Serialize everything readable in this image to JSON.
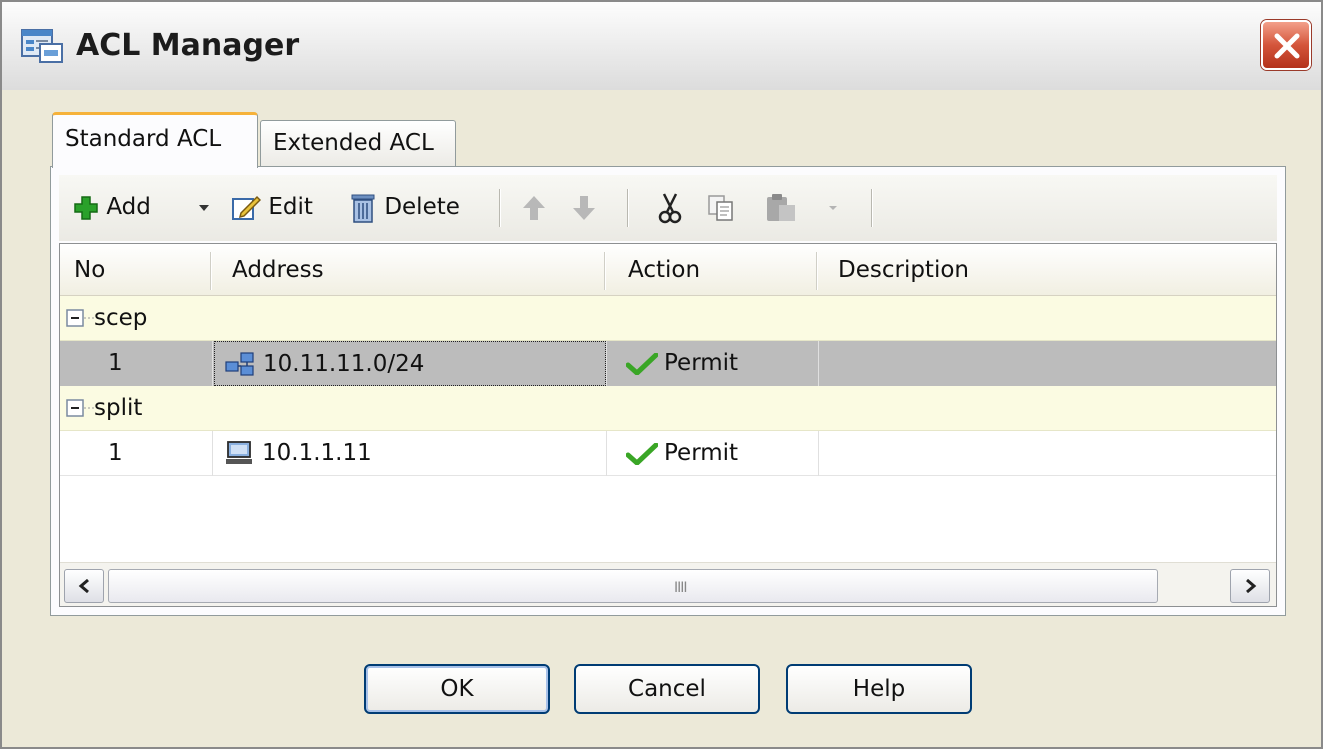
{
  "window": {
    "title": "ACL Manager",
    "icon": "acl-manager-app-icon",
    "close_icon": "close-x-icon"
  },
  "tabs": [
    {
      "label": "Standard ACL",
      "selected": true
    },
    {
      "label": "Extended ACL",
      "selected": false
    }
  ],
  "toolbar": {
    "add_label": "Add",
    "edit_label": "Edit",
    "delete_label": "Delete",
    "icons": [
      "plus-icon",
      "dropdown-arrow-icon",
      "edit-icon",
      "trash-icon",
      "move-up-icon",
      "move-down-icon",
      "cut-icon",
      "copy-icon",
      "paste-icon",
      "paste-dropdown-icon"
    ]
  },
  "table": {
    "columns": [
      "No",
      "Address",
      "Action",
      "Description"
    ],
    "groups": [
      {
        "name": "scep",
        "rows": [
          {
            "no": "1",
            "address": "10.11.11.0/24",
            "address_icon": "network-icon",
            "action": "Permit",
            "action_icon": "checkmark-icon",
            "description": "",
            "selected": true
          }
        ]
      },
      {
        "name": "split",
        "rows": [
          {
            "no": "1",
            "address": "10.1.1.11",
            "address_icon": "host-computer-icon",
            "action": "Permit",
            "action_icon": "checkmark-icon",
            "description": "",
            "selected": false
          }
        ]
      }
    ]
  },
  "buttons": {
    "ok": "OK",
    "cancel": "Cancel",
    "help": "Help"
  },
  "colors": {
    "selected_row": "#bcbcbc",
    "group_row": "#fbfbe2",
    "add_green": "#2aa12a",
    "check_green": "#3aa626",
    "close_red": "#d4553b",
    "tab_highlight": "#f6b23a"
  }
}
